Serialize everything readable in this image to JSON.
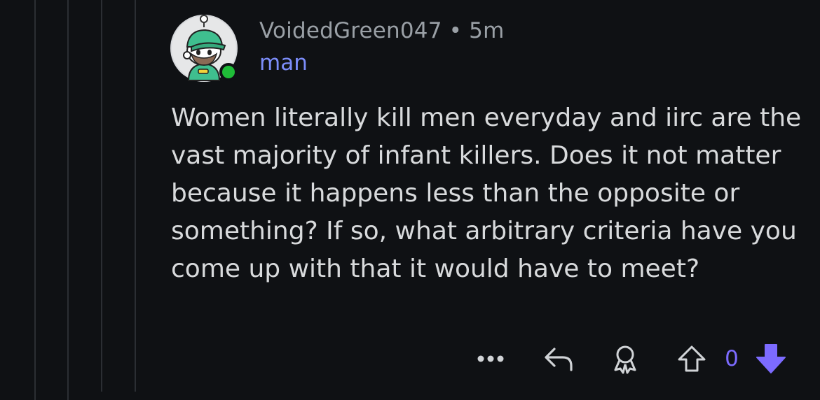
{
  "comment": {
    "author": "VoidedGreen047",
    "separator": "•",
    "age": "5m",
    "flair": "man",
    "body": "Women literally kill men everyday and iirc are the vast majority of infant killers. Does it not matter because it happens less than the opposite or something? If so, what arbitrary criteria have you come up with that it would have to meet?",
    "score": "0"
  },
  "actions": {
    "more_icon": "ellipsis-icon",
    "reply_icon": "reply-arrow-icon",
    "award_icon": "award-icon",
    "upvote_icon": "upvote-arrow-outline-icon",
    "downvote_icon": "downvote-arrow-filled-icon"
  },
  "colors": {
    "background": "#0f1114",
    "text": "#d8dadc",
    "muted": "#9aa0a6",
    "flair": "#7c8dfa",
    "downvote": "#7c6bff",
    "online": "#1fbd38"
  }
}
